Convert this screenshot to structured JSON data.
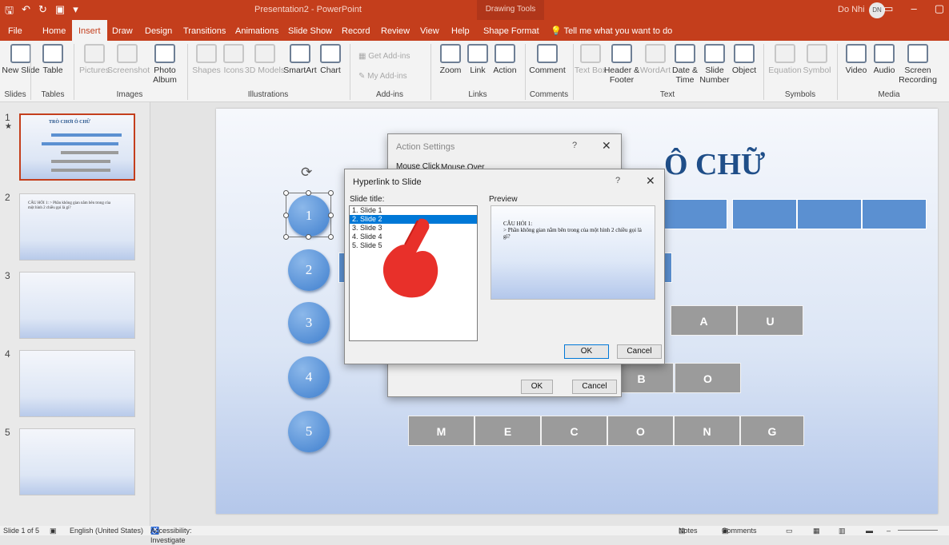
{
  "title_bar": {
    "doc_title": "Presentation2 - PowerPoint",
    "context_tab": "Drawing Tools",
    "user_name": "Do Nhi",
    "user_initials": "DN"
  },
  "tabs": [
    "File",
    "Home",
    "Insert",
    "Draw",
    "Design",
    "Transitions",
    "Animations",
    "Slide Show",
    "Record",
    "Review",
    "View",
    "Help",
    "Shape Format"
  ],
  "tell_me": "Tell me what you want to do",
  "ribbon": {
    "buttons": {
      "new_slide": "New Slide",
      "table": "Table",
      "pictures": "Pictures",
      "screenshot": "Screenshot",
      "photo_album": "Photo Album",
      "shapes": "Shapes",
      "icons": "Icons",
      "models_3d": "3D Models",
      "smartart": "SmartArt",
      "chart": "Chart",
      "get_addins": "Get Add-ins",
      "my_addins": "My Add-ins",
      "zoom": "Zoom",
      "link": "Link",
      "action": "Action",
      "comment": "Comment",
      "text_box": "Text Box",
      "header_footer": "Header & Footer",
      "wordart": "WordArt",
      "date_time": "Date & Time",
      "slide_number": "Slide Number",
      "object": "Object",
      "equation": "Equation",
      "symbol": "Symbol",
      "video": "Video",
      "audio": "Audio",
      "screen_recording": "Screen Recording"
    },
    "groups": {
      "slides": "Slides",
      "tables": "Tables",
      "images": "Images",
      "illustrations": "Illustrations",
      "addins": "Add-ins",
      "links": "Links",
      "comments": "Comments",
      "text": "Text",
      "symbols": "Symbols",
      "media": "Media"
    }
  },
  "thumbnails": [
    {
      "num": "1",
      "text": "TRÒ CHƠI Ô CHỮ"
    },
    {
      "num": "2",
      "text": "CÂU HỎI 1: > Phần không gian nằm bên trong của một hình 2 chiều gọi là gì?"
    },
    {
      "num": "3",
      "text": ""
    },
    {
      "num": "4",
      "text": ""
    },
    {
      "num": "5",
      "text": ""
    }
  ],
  "slide": {
    "title_fragment": "Ô CHỮ",
    "circles": [
      "1",
      "2",
      "3",
      "4",
      "5"
    ],
    "row3_letters": [
      "A",
      "U"
    ],
    "row4_letters": [
      "B",
      "O"
    ],
    "row5_letters": [
      "M",
      "E",
      "C",
      "O",
      "N",
      "G"
    ]
  },
  "action_dialog": {
    "title": "Action Settings",
    "tab_mouse_click": "Mouse Click",
    "tab_mouse_over": "Mouse Over",
    "ok": "OK",
    "cancel": "Cancel"
  },
  "hyperlink_dialog": {
    "title": "Hyperlink to Slide",
    "help": "?",
    "slide_title_label": "Slide title:",
    "preview_label": "Preview",
    "items": [
      "1. Slide 1",
      "2. Slide 2",
      "3. Slide 3",
      "4. Slide 4",
      "5. Slide 5"
    ],
    "selected_index": 1,
    "preview_text": "CÂU HỎI 1:\n> Phần không gian nằm bên trong của một hình 2 chiều gọi là gì?",
    "ok": "OK",
    "cancel": "Cancel"
  },
  "status_bar": {
    "slide_count": "Slide 1 of 5",
    "language": "English (United States)",
    "accessibility": "Accessibility: Investigate",
    "notes": "Notes",
    "comments": "Comments"
  }
}
